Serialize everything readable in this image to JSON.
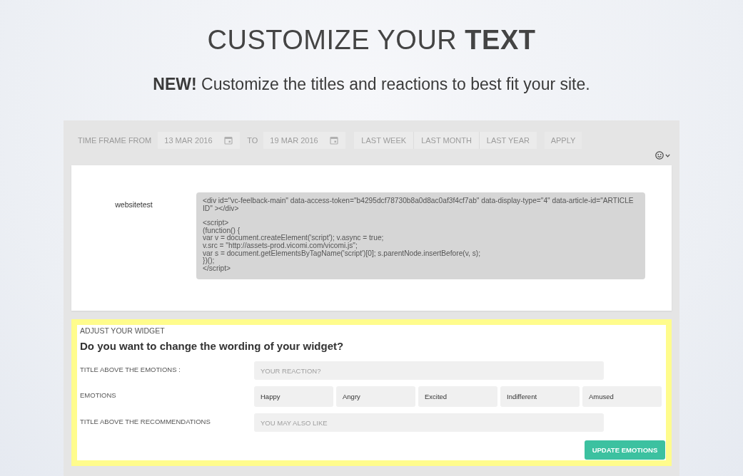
{
  "title": "CUSTOMIZE YOUR **TEXT**",
  "subtitle": "**NEW!** Customize the titles and reactions to best fit your site.",
  "filter_bar": {
    "from_label": "TIME FRAME FROM",
    "from_date": "13 MAR 2016",
    "to_label": "TO",
    "to_date": "19 MAR 2016",
    "ranges": [
      {
        "label": "LAST WEEK",
        "selected": false
      },
      {
        "label": "LAST MONTH",
        "selected": false
      },
      {
        "label": "LAST YEAR",
        "selected": false
      }
    ],
    "apply_button": "APPLY"
  },
  "embed": {
    "site": "websitetest",
    "code_blocks": [
      [
        "<div id=\"vc-feelback-main\" data-access-token=\"b4295dcf78730b8a0d8ac0af3f4cf7ab\" data-display-type=\"4\" data-article-id=\"ARTICLE ID\" ></div>"
      ],
      [
        "<script>",
        "(function() {",
        "var v = document.createElement('script'); v.async = true;",
        "v.src = \"http://assets-prod.vicomi.com/vicomi.js\";",
        "var s = document.getElementsByTagName('script')[0]; s.parentNode.insertBefore(v, s);",
        "})();",
        "</script>"
      ]
    ]
  },
  "widget": {
    "highlighted": true,
    "section_label": "ADJUST YOUR WIDGET",
    "question": "Do you want to change the wording of your widget?",
    "rows": [
      {
        "kind": "text",
        "label": "TITLE ABOVE THE EMOTIONS :",
        "placeholder": "YOUR REACTION?"
      },
      {
        "kind": "emotions",
        "label": "EMOTIONS",
        "values": [
          "Happy",
          "Angry",
          "Excited",
          "Indifferent",
          "Amused"
        ]
      },
      {
        "kind": "text",
        "label": "TITLE ABOVE THE RECOMMENDATIONS",
        "placeholder": "YOU MAY ALSO LIKE"
      }
    ],
    "submit_button": "UPDATE EMOTIONS"
  }
}
